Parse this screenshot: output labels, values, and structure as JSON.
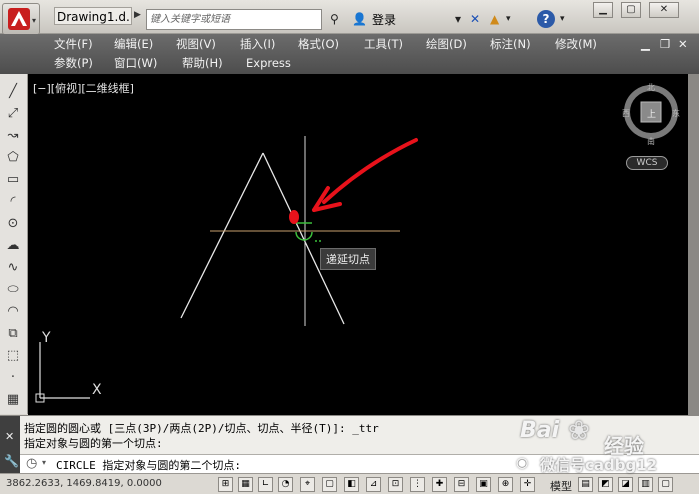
{
  "titlebar": {
    "document_title": "Drawing1.d...",
    "search_placeholder": "键入关键字或短语",
    "login_label": "登录"
  },
  "menu": {
    "row1": [
      "文件(F)",
      "编辑(E)",
      "视图(V)",
      "插入(I)",
      "格式(O)",
      "工具(T)",
      "绘图(D)",
      "标注(N)",
      "修改(M)"
    ],
    "row2": [
      "参数(P)",
      "窗口(W)",
      "帮助(H)",
      "Express"
    ]
  },
  "viewport": {
    "view_label": "[−][俯视][二维线框]",
    "tooltip": "递延切点",
    "compass": {
      "north": "北",
      "south": "南",
      "east": "东",
      "west": "西",
      "center": "上"
    },
    "wcs_label": "WCS",
    "ucs_x": "X",
    "ucs_y": "Y"
  },
  "command": {
    "history": [
      "指定圆的圆心或 [三点(3P)/两点(2P)/切点、切点、半径(T)]: _ttr",
      "指定对象与圆的第一个切点:"
    ],
    "prompt": "CIRCLE 指定对象与圆的第二个切点:"
  },
  "status": {
    "coordinates": "3862.2633, 1469.8419, 0.0000",
    "model_label": "模型"
  },
  "watermark": {
    "baidu": "Bai",
    "jingyan": "经验",
    "wechat": "微信号cadbg12"
  },
  "colors": {
    "canvas": "#000000",
    "arrow": "#e8121b",
    "menubar": "#555555",
    "crosshair_h": "#c8a06e"
  }
}
